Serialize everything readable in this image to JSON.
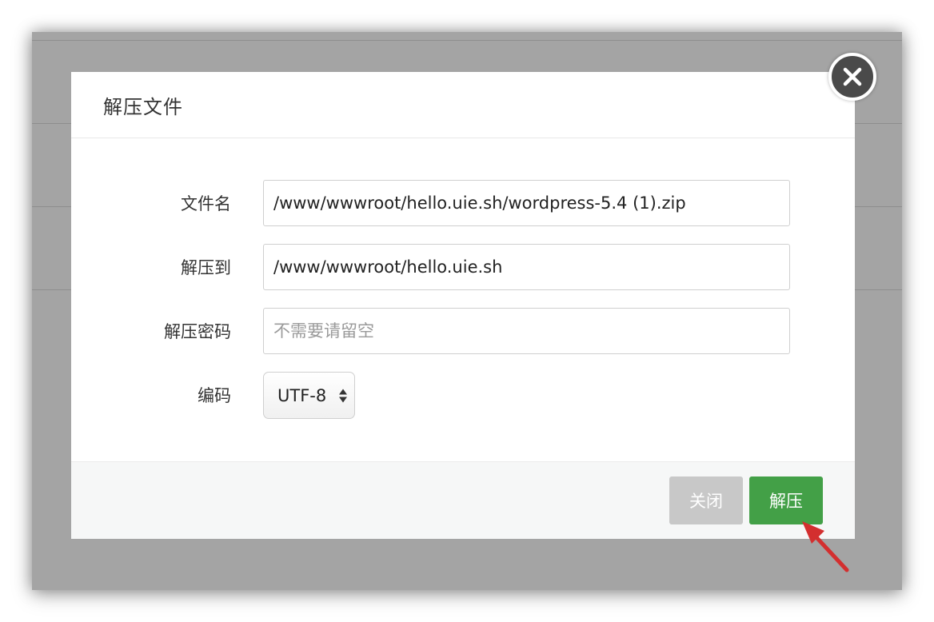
{
  "dialog": {
    "title": "解压文件",
    "fields": {
      "filename_label": "文件名",
      "filename_value": "/www/wwwroot/hello.uie.sh/wordpress-5.4 (1).zip",
      "extract_to_label": "解压到",
      "extract_to_value": "/www/wwwroot/hello.uie.sh",
      "password_label": "解压密码",
      "password_placeholder": "不需要请留空",
      "encoding_label": "编码",
      "encoding_value": "UTF-8"
    },
    "footer": {
      "close_label": "关闭",
      "extract_label": "解压"
    }
  },
  "colors": {
    "extract_button": "#43a047",
    "close_button": "#c8c8c8",
    "annotation_arrow": "#d32f2f"
  },
  "icons": {
    "dialog_close": "close-icon",
    "select_arrows": "updown-arrows-icon",
    "annotation": "red-arrow-icon"
  }
}
